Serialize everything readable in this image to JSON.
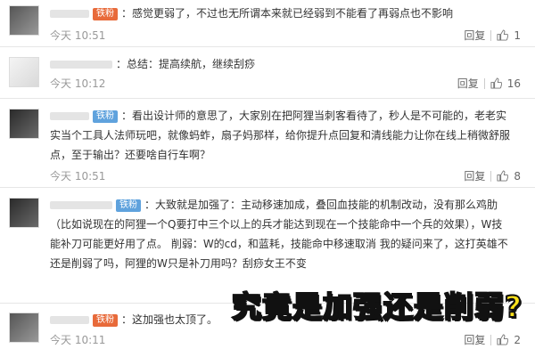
{
  "comments": [
    {
      "badge": "铁粉",
      "text": "：感觉更弱了，不过也无所谓本来就已经弱到不能看了再弱点也不影响",
      "time": "今天 10:51",
      "reply": "回复",
      "likes": "1"
    },
    {
      "badge": "",
      "text": "：总结：提高续航，继续刮痧",
      "time": "今天 10:12",
      "reply": "回复",
      "likes": "16"
    },
    {
      "badge": "铁粉",
      "text_lines": [
        "：看出设计师的意思了，大家别在把阿狸当刺客看待了，秒人是不可能的，老老实",
        "实当个工具人法师玩吧，就像蚂蚱，扇子妈那样，给你提升点回复和清线能力让你在线上稍微舒服",
        "点，至于输出？还要啥自行车啊？"
      ],
      "time": "今天 10:51",
      "reply": "回复",
      "likes": "8"
    },
    {
      "badge": "铁粉",
      "text_lines": [
        "：大致就是加强了：主动移速加成，叠回血技能的机制改动，没有那么鸡肋",
        "（比如说现在的阿狸一个Q要打中三个以上的兵才能达到现在一个技能命中一个兵的效果），W技",
        "能补刀可能更好用了点。  削弱：W的cd，和蓝耗，技能命中移速取消 我的疑问来了，这打英雄不",
        "还是削弱了吗，阿狸的W只是补刀用吗？刮痧女王不变"
      ],
      "time": "",
      "reply": "",
      "likes": ""
    },
    {
      "badge": "铁粉",
      "text": "：这加强也太顶了。",
      "time": "今天 10:11",
      "reply": "回复",
      "likes": "2"
    }
  ],
  "overlay_caption": "究竟是加强还是削弱?",
  "colors": {
    "badge_orange": "#e86a3a",
    "badge_blue": "#5fa2dd",
    "caption": "#ffe21a"
  },
  "icons": {
    "like": "thumbs-up-icon"
  }
}
